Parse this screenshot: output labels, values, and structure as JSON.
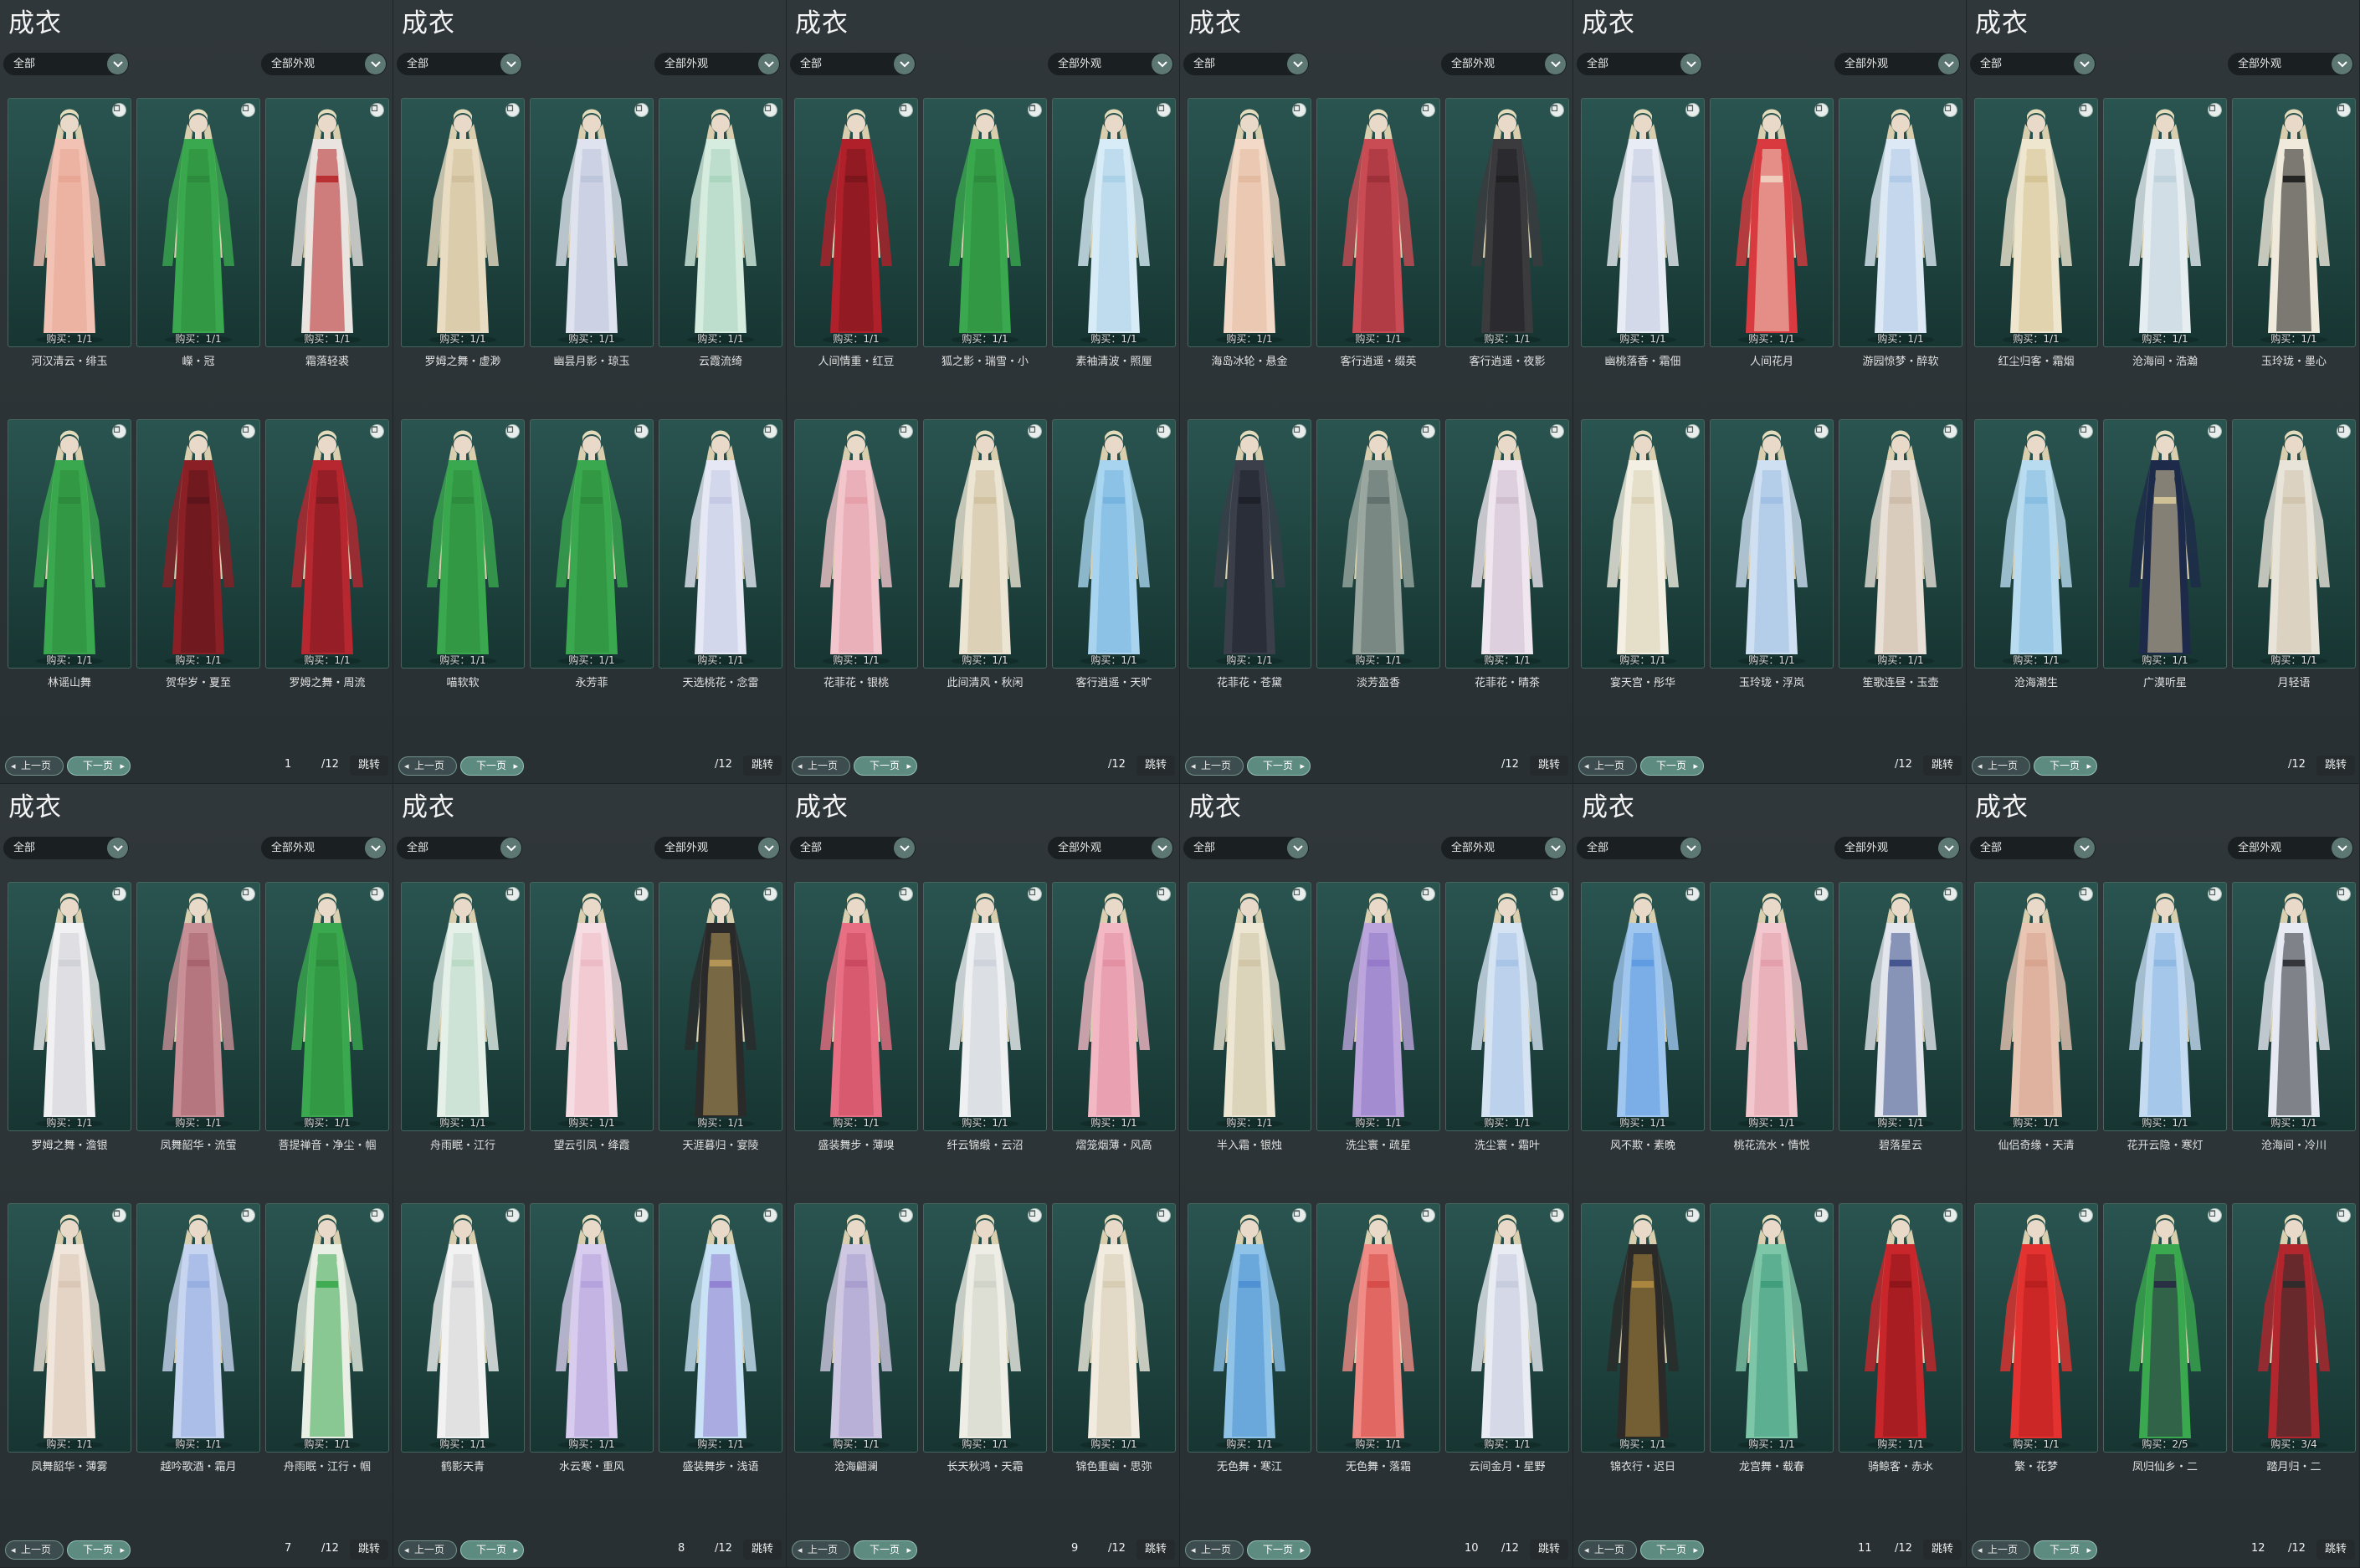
{
  "panels": [
    {
      "title": "成衣",
      "category": "全部",
      "appearance": "全部外观",
      "page": "1",
      "total": "/12",
      "jump": "跳转",
      "prev": "上一页",
      "next": "下一页",
      "items": [
        {
          "name": "河汉清云・绯玉",
          "buy": "购买：1/1",
          "colors": [
            "#f2c2b4",
            "#e8a594"
          ],
          "icon": "trash-icon"
        },
        {
          "name": "嶸・冠",
          "buy": "购买：1/1",
          "colors": [
            "#3aa84e",
            "#2b8a3d"
          ],
          "icon": "trash-icon"
        },
        {
          "name": "霜落轻裘",
          "buy": "购买：1/1",
          "colors": [
            "#e9e4e0",
            "#b8282a"
          ],
          "icon": "trash-icon"
        },
        {
          "name": "林谣山舞",
          "buy": "购买：1/1",
          "colors": [
            "#3aa84e",
            "#2b8a3d"
          ],
          "icon": "recycle-icon"
        },
        {
          "name": "贺华岁・夏至",
          "buy": "购买：1/1",
          "colors": [
            "#8a1f26",
            "#5b1419"
          ],
          "icon": "trash-icon"
        },
        {
          "name": "罗姆之舞・周流",
          "buy": "购买：1/1",
          "colors": [
            "#b72730",
            "#7c1a20"
          ],
          "icon": "trash-icon"
        }
      ]
    },
    {
      "title": "成衣",
      "category": "全部",
      "appearance": "全部外观",
      "page": "",
      "total": "/12",
      "jump": "跳转",
      "prev": "上一页",
      "next": "下一页",
      "items": [
        {
          "name": "罗姆之舞・虚渺",
          "buy": "购买：1/1",
          "colors": [
            "#e8dcc2",
            "#cfbf9b"
          ],
          "icon": "trash-icon"
        },
        {
          "name": "幽昙月影・琼玉",
          "buy": "购买：1/1",
          "colors": [
            "#dfe3ef",
            "#bcc4da"
          ],
          "icon": "trash-icon"
        },
        {
          "name": "云霞流绮",
          "buy": "购买：1/1",
          "colors": [
            "#d5ecde",
            "#a9d4bd"
          ],
          "icon": "trash-icon"
        },
        {
          "name": "喵软软",
          "buy": "购买：1/1",
          "colors": [
            "#3aa84e",
            "#2b8a3d"
          ],
          "icon": "recycle-icon"
        },
        {
          "name": "永芳菲",
          "buy": "购买：1/1",
          "colors": [
            "#3aa84e",
            "#2b8a3d"
          ],
          "icon": "recycle-icon"
        },
        {
          "name": "天选桃花・念雷",
          "buy": "购买：1/1",
          "colors": [
            "#e6e9f5",
            "#c3c8e2"
          ],
          "icon": "recycle-icon"
        }
      ]
    },
    {
      "title": "成衣",
      "category": "全部",
      "appearance": "全部外观",
      "page": "",
      "total": "/12",
      "jump": "跳转",
      "prev": "上一页",
      "next": "下一页",
      "items": [
        {
          "name": "人间情重・红豆",
          "buy": "购买：1/1",
          "colors": [
            "#b0202a",
            "#7a151c"
          ],
          "icon": "trash-icon"
        },
        {
          "name": "狐之影・瑞雪・小",
          "buy": "购买：1/1",
          "colors": [
            "#3aa84e",
            "#2b8a3d"
          ],
          "icon": "recycle-icon"
        },
        {
          "name": "素袖清波・照厘",
          "buy": "购买：1/1",
          "colors": [
            "#d8ecf7",
            "#a9cfe6"
          ],
          "icon": "recycle-icon"
        },
        {
          "name": "花菲花・银桃",
          "buy": "购买：1/1",
          "colors": [
            "#f2c6cc",
            "#e49ea9"
          ],
          "icon": "trash-icon"
        },
        {
          "name": "此间清风・秋闲",
          "buy": "购买：1/1",
          "colors": [
            "#ece5d3",
            "#cfc1a0"
          ],
          "icon": "recycle-icon"
        },
        {
          "name": "客行逍遥・天旷",
          "buy": "购买：1/1",
          "colors": [
            "#a8d4ef",
            "#74b2de"
          ],
          "icon": "recycle-icon"
        }
      ]
    },
    {
      "title": "成衣",
      "category": "全部",
      "appearance": "全部外观",
      "page": "",
      "total": "/12",
      "jump": "跳转",
      "prev": "上一页",
      "next": "下一页",
      "items": [
        {
          "name": "海岛冰轮・悬金",
          "buy": "购买：1/1",
          "colors": [
            "#f3d9c7",
            "#e2b99e"
          ],
          "icon": "trash-icon"
        },
        {
          "name": "客行逍遥・缀英",
          "buy": "购买：1/1",
          "colors": [
            "#c94c54",
            "#9c2f38"
          ],
          "icon": "trash-icon"
        },
        {
          "name": "客行逍遥・夜影",
          "buy": "购买：1/1",
          "colors": [
            "#3b3b3e",
            "#1f1f22"
          ],
          "icon": "trash-icon"
        },
        {
          "name": "花菲花・苍黛",
          "buy": "购买：1/1",
          "colors": [
            "#3a3f4a",
            "#1d2029"
          ],
          "icon": "trash-icon"
        },
        {
          "name": "淡芳盈香",
          "buy": "购买：1/1",
          "colors": [
            "#9aa7a0",
            "#5f6f6a"
          ],
          "icon": "trash-icon"
        },
        {
          "name": "花菲花・晴茶",
          "buy": "购买：1/1",
          "colors": [
            "#efe6ef",
            "#cdbccd"
          ],
          "icon": "trash-icon"
        }
      ]
    },
    {
      "title": "成衣",
      "category": "全部",
      "appearance": "全部外观",
      "page": "",
      "total": "/12",
      "jump": "跳转",
      "prev": "上一页",
      "next": "下一页",
      "items": [
        {
          "name": "幽桃落香・霜佃",
          "buy": "购买：1/1",
          "colors": [
            "#e8ecf4",
            "#c2cbe0"
          ],
          "icon": "trash-icon"
        },
        {
          "name": "人间花月",
          "buy": "购买：1/1",
          "colors": [
            "#d83a3f",
            "#f1d3c3"
          ],
          "icon": "trash-icon"
        },
        {
          "name": "游园惊梦・醉软",
          "buy": "购买：1/1",
          "colors": [
            "#dde9f5",
            "#afc9e6"
          ],
          "icon": "trash-icon"
        },
        {
          "name": "宴天宫・彤华",
          "buy": "购买：1/1",
          "colors": [
            "#f3efe2",
            "#d9cfb4"
          ],
          "icon": "trash-icon"
        },
        {
          "name": "玉玲珑・浮岚",
          "buy": "购买：1/1",
          "colors": [
            "#cfe0f2",
            "#9ebfe3"
          ],
          "icon": "trash-icon"
        },
        {
          "name": "笙歌连昼・玉壶",
          "buy": "购买：1/1",
          "colors": [
            "#e9e1d8",
            "#cdbba8"
          ],
          "icon": "trash-icon"
        }
      ]
    },
    {
      "title": "成衣",
      "category": "全部",
      "appearance": "全部外观",
      "page": "",
      "total": "/12",
      "jump": "跳转",
      "prev": "上一页",
      "next": "下一页",
      "items": [
        {
          "name": "红尘归客・霜烟",
          "buy": "购买：1/1",
          "colors": [
            "#efe6cf",
            "#d4c294"
          ],
          "icon": "trash-icon"
        },
        {
          "name": "沧海间・浩瀚",
          "buy": "购买：1/1",
          "colors": [
            "#e6eef2",
            "#bfd2dc"
          ],
          "icon": "recycle-icon"
        },
        {
          "name": "玉玲珑・墨心",
          "buy": "购买：1/1",
          "colors": [
            "#f0eadc",
            "#1b1b1b"
          ],
          "icon": "recycle-icon"
        },
        {
          "name": "沧海潮生",
          "buy": "购买：1/1",
          "colors": [
            "#b9dcf0",
            "#86bde0"
          ],
          "icon": "trash-icon"
        },
        {
          "name": "广漠听星",
          "buy": "购买：1/1",
          "colors": [
            "#1d2a4a",
            "#d8c79a"
          ],
          "icon": "trash-icon"
        },
        {
          "name": "月轻语",
          "buy": "购买：1/1",
          "colors": [
            "#e9e4da",
            "#cfc3ad"
          ],
          "icon": "trash-icon"
        }
      ]
    },
    {
      "title": "成衣",
      "category": "全部",
      "appearance": "全部外观",
      "page": "7",
      "total": "/12",
      "jump": "跳转",
      "prev": "上一页",
      "next": "下一页",
      "items": [
        {
          "name": "罗姆之舞・澹银",
          "buy": "购买：1/1",
          "colors": [
            "#f1f1f3",
            "#cfd0d6"
          ],
          "icon": "trash-icon"
        },
        {
          "name": "凤舞韶华・流萤",
          "buy": "购买：1/1",
          "colors": [
            "#c98f96",
            "#a5626d"
          ],
          "icon": "trash-icon"
        },
        {
          "name": "菩提禅音・净尘・帼",
          "buy": "购买：1/1",
          "colors": [
            "#3aa84e",
            "#2b8a3d"
          ],
          "icon": "trash-icon"
        },
        {
          "name": "凤舞韶华・薄雾",
          "buy": "购买：1/1",
          "colors": [
            "#f1e6dc",
            "#d8c5b4"
          ],
          "icon": "recycle-icon"
        },
        {
          "name": "越吟歌酒・霜月",
          "buy": "购买：1/1",
          "colors": [
            "#c7d5f1",
            "#93acdf"
          ],
          "icon": "trash-icon"
        },
        {
          "name": "舟雨眠・江行・帼",
          "buy": "购买：1/1",
          "colors": [
            "#e9efe4",
            "#3aa84e"
          ],
          "icon": "recycle-icon"
        }
      ]
    },
    {
      "title": "成衣",
      "category": "全部",
      "appearance": "全部外观",
      "page": "8",
      "total": "/12",
      "jump": "跳转",
      "prev": "上一页",
      "next": "下一页",
      "items": [
        {
          "name": "舟雨眠・江行",
          "buy": "购买：1/1",
          "colors": [
            "#e4f0e8",
            "#b9d8c4"
          ],
          "icon": "recycle-icon"
        },
        {
          "name": "望云引凤・绛霞",
          "buy": "购买：1/1",
          "colors": [
            "#f6dde3",
            "#ecb9c4"
          ],
          "icon": "trash-icon"
        },
        {
          "name": "天涯暮归・宴陵",
          "buy": "购买：1/1",
          "colors": [
            "#2a2a2a",
            "#b99a5a"
          ],
          "icon": "trash-icon"
        },
        {
          "name": "鹤影天青",
          "buy": "购买：1/1",
          "colors": [
            "#f2f2f2",
            "#d4d4d6"
          ],
          "icon": "trash-icon"
        },
        {
          "name": "水云寒・重风",
          "buy": "购买：1/1",
          "colors": [
            "#d8cdee",
            "#b4a1dd"
          ],
          "icon": "recycle-icon"
        },
        {
          "name": "盛装舞步・浅语",
          "buy": "购买：1/1",
          "colors": [
            "#c9e2f5",
            "#8f7fd0"
          ],
          "icon": "recycle-icon"
        }
      ]
    },
    {
      "title": "成衣",
      "category": "全部",
      "appearance": "全部外观",
      "page": "9",
      "total": "/12",
      "jump": "跳转",
      "prev": "上一页",
      "next": "下一页",
      "items": [
        {
          "name": "盛装舞步・薄嗅",
          "buy": "购买：1/1",
          "colors": [
            "#e86f83",
            "#c9485f"
          ],
          "icon": "recycle-icon"
        },
        {
          "name": "纤云锦缎・云沼",
          "buy": "购买：1/1",
          "colors": [
            "#eef0f2",
            "#cdd3da"
          ],
          "icon": "trash-icon"
        },
        {
          "name": "熠笼烟薄・风高",
          "buy": "购买：1/1",
          "colors": [
            "#f2b8c4",
            "#e28ea2"
          ],
          "icon": "recycle-icon"
        },
        {
          "name": "沧海翩澜",
          "buy": "购买：1/1",
          "colors": [
            "#cfc8e2",
            "#a79ccd"
          ],
          "icon": "recycle-icon"
        },
        {
          "name": "长天秋鸿・天霜",
          "buy": "购买：1/1",
          "colors": [
            "#eeeee6",
            "#cfd3c6"
          ],
          "icon": "recycle-icon"
        },
        {
          "name": "锦色重幽・思弥",
          "buy": "购买：1/1",
          "colors": [
            "#f1ecdf",
            "#d6cbb2"
          ],
          "icon": "recycle-icon"
        }
      ]
    },
    {
      "title": "成衣",
      "category": "全部",
      "appearance": "全部外观",
      "page": "10",
      "total": "/12",
      "jump": "跳转",
      "prev": "上一页",
      "next": "下一页",
      "items": [
        {
          "name": "半入霜・银烛",
          "buy": "购买：1/1",
          "colors": [
            "#ece6d3",
            "#cfc4a6"
          ],
          "icon": "recycle-icon"
        },
        {
          "name": "洗尘寰・疏星",
          "buy": "购买：1/1",
          "colors": [
            "#bba5dc",
            "#9278c8"
          ],
          "icon": "recycle-icon"
        },
        {
          "name": "洗尘寰・霜叶",
          "buy": "购买：1/1",
          "colors": [
            "#d5e3f3",
            "#a6c2e6"
          ],
          "icon": "recycle-icon"
        },
        {
          "name": "无色舞・寒江",
          "buy": "购买：1/1",
          "colors": [
            "#8fc3e8",
            "#4c8fd0"
          ],
          "icon": "trash-icon"
        },
        {
          "name": "无色舞・落霜",
          "buy": "购买：1/1",
          "colors": [
            "#f08b86",
            "#d64a47"
          ],
          "icon": "trash-icon"
        },
        {
          "name": "云间金月・星野",
          "buy": "购买：1/1",
          "colors": [
            "#e9ecf3",
            "#c5cbdc"
          ],
          "icon": "recycle-icon"
        }
      ]
    },
    {
      "title": "成衣",
      "category": "全部",
      "appearance": "全部外观",
      "page": "11",
      "total": "/12",
      "jump": "跳转",
      "prev": "上一页",
      "next": "下一页",
      "items": [
        {
          "name": "风不欺・素晚",
          "buy": "购买：1/1",
          "colors": [
            "#9fc6ef",
            "#5d9ae0"
          ],
          "icon": "recycle-icon"
        },
        {
          "name": "桃花流水・情悦",
          "buy": "购买：1/1",
          "colors": [
            "#f2c7cd",
            "#e29fab"
          ],
          "icon": "trash-icon"
        },
        {
          "name": "碧落星云",
          "buy": "购买：1/1",
          "colors": [
            "#e4e6ee",
            "#3d4f8c"
          ],
          "icon": "recycle-icon"
        },
        {
          "name": "锦衣行・迟日",
          "buy": "购买：1/1",
          "colors": [
            "#2b2a28",
            "#b08a3e"
          ],
          "icon": "recycle-icon"
        },
        {
          "name": "龙宫舞・载春",
          "buy": "购买：1/1",
          "colors": [
            "#7ec6a8",
            "#3f9d7b"
          ],
          "icon": "recycle-icon"
        },
        {
          "name": "骑鲸客・赤水",
          "buy": "购买：1/1",
          "colors": [
            "#c9262b",
            "#8d1519"
          ],
          "icon": "recycle-icon"
        }
      ]
    },
    {
      "title": "成衣",
      "category": "全部",
      "appearance": "全部外观",
      "page": "12",
      "total": "/12",
      "jump": "跳转",
      "prev": "上一页",
      "next": "下一页",
      "items": [
        {
          "name": "仙侣奇缘・天清",
          "buy": "购买：1/1",
          "colors": [
            "#e9c6b4",
            "#d6a38d"
          ],
          "icon": "recycle-icon"
        },
        {
          "name": "花开云隐・寒灯",
          "buy": "购买：1/1",
          "colors": [
            "#c4dbf2",
            "#8db7e2"
          ],
          "icon": "recycle-icon"
        },
        {
          "name": "沧海间・冷川",
          "buy": "购买：1/1",
          "colors": [
            "#e7eaf3",
            "#2c2c33"
          ],
          "icon": "recycle-icon"
        },
        {
          "name": "繁・花梦",
          "buy": "购买：1/1",
          "colors": [
            "#e3322f",
            "#b81f1f"
          ],
          "icon": "trash-icon"
        },
        {
          "name": "凤归仙乡・二",
          "buy": "购买：2/5",
          "colors": [
            "#3aa84e",
            "#2a2a44"
          ],
          "icon": "recycle-icon"
        },
        {
          "name": "踏月归・二",
          "buy": "购买：3/4",
          "colors": [
            "#b2262d",
            "#2b2b2b"
          ],
          "icon": "recycle-icon"
        }
      ]
    }
  ]
}
